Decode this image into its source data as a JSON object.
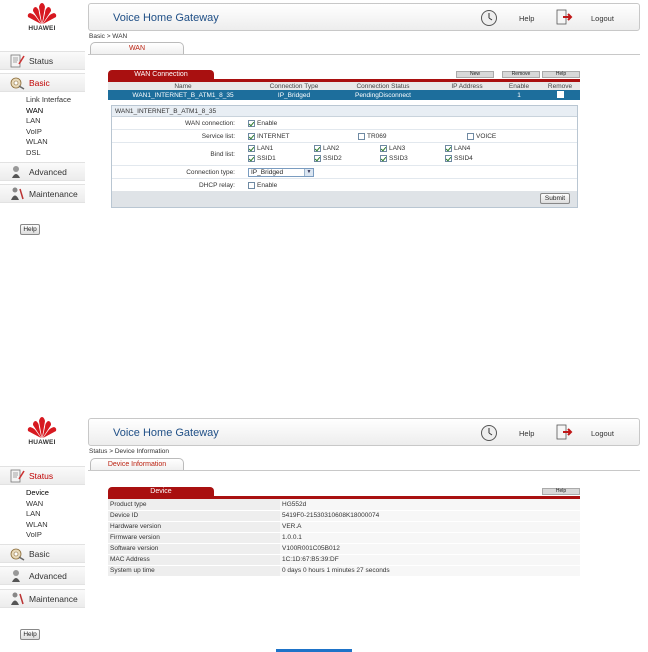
{
  "app": {
    "title": "Voice Home Gateway",
    "help": "Help",
    "logout": "Logout",
    "brand": "HUAWEI",
    "help_button": "Help"
  },
  "wan_screen": {
    "nav": {
      "status": "Status",
      "basic": "Basic",
      "basic_items": [
        "Link Interface",
        "WAN",
        "LAN",
        "VoIP",
        "WLAN",
        "DSL"
      ],
      "advanced": "Advanced",
      "maintenance": "Maintenance"
    },
    "breadcrumb": "Basic > WAN",
    "tab": "WAN",
    "section_title": "WAN Connection",
    "buttons": {
      "new": "New",
      "remove": "Remove",
      "help": "Help"
    },
    "table": {
      "headers": [
        "Name",
        "Connection Type",
        "Connection Status",
        "IP Address",
        "Enable",
        "Remove"
      ],
      "rows": [
        {
          "name": "WAN1_INTERNET_B_ATM1_8_35",
          "type": "IP_Bridged",
          "status": "PendingDisconnect",
          "ip": "",
          "enable": "1"
        }
      ]
    },
    "detail": {
      "title": "WAN1_INTERNET_B_ATM1_8_35",
      "labels": {
        "wan_connection": "WAN connection:",
        "service_list": "Service list:",
        "bind_list": "Bind list:",
        "connection_type": "Connection type:",
        "dhcp_relay": "DHCP relay:"
      },
      "enable": "Enable",
      "services": [
        "INTERNET",
        "TR069",
        "VOICE"
      ],
      "bind_lan": [
        "LAN1",
        "LAN2",
        "LAN3",
        "LAN4"
      ],
      "bind_ssid": [
        "SSID1",
        "SSID2",
        "SSID3",
        "SSID4"
      ],
      "connection_type_value": "IP_Bridged",
      "dhcp_enable": "Enable",
      "submit": "Submit"
    }
  },
  "device_screen": {
    "nav": {
      "status": "Status",
      "status_items": [
        "Device",
        "WAN",
        "LAN",
        "WLAN",
        "VoIP"
      ],
      "basic": "Basic",
      "advanced": "Advanced",
      "maintenance": "Maintenance"
    },
    "breadcrumb": "Status > Device Information",
    "tab": "Device Information",
    "section_title": "Device",
    "help": "Help",
    "rows": [
      {
        "key": "Product type",
        "value": "HG552d"
      },
      {
        "key": "Device ID",
        "value": "5419F0-21530310608K18000074"
      },
      {
        "key": "Hardware version",
        "value": "VER.A"
      },
      {
        "key": "Firmware version",
        "value": "1.0.0.1"
      },
      {
        "key": "Software version",
        "value": "V100R001C05B012"
      },
      {
        "key": "MAC Address",
        "value": "1C:1D:67:B5:39:DF"
      },
      {
        "key": "System up time",
        "value": "0 days 0 hours 1 minutes 27 seconds"
      }
    ]
  }
}
